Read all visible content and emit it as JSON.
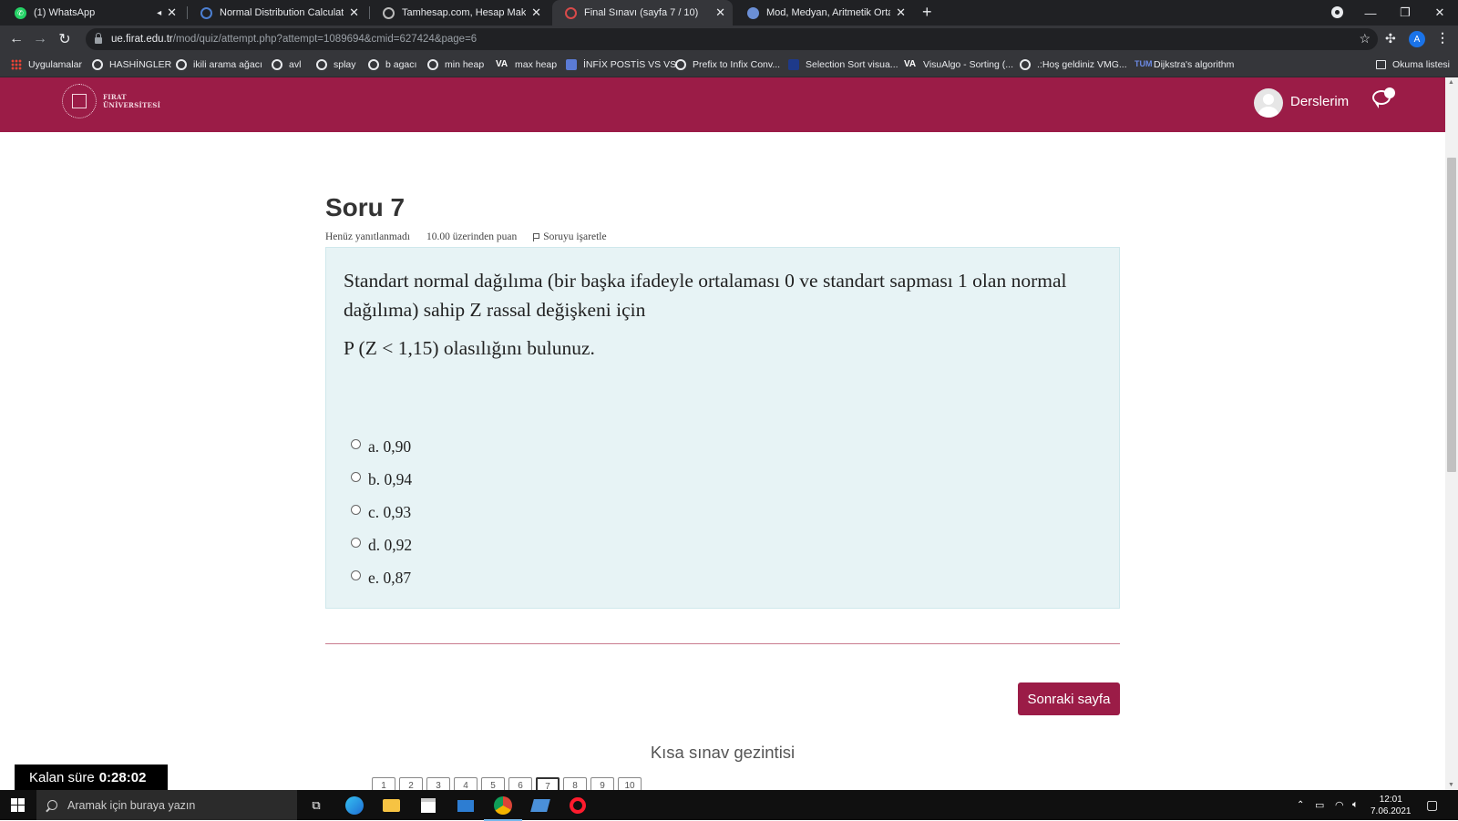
{
  "browser": {
    "tabs": [
      {
        "title": "(1) WhatsApp",
        "muted": true
      },
      {
        "title": "Normal Distribution Calculator | Ir"
      },
      {
        "title": "Tamhesap.com, Hesap Makinesi, Ç"
      },
      {
        "title": "Final Sınavı (sayfa 7 / 10)",
        "active": true
      },
      {
        "title": "Mod, Medyan, Aritmetik Ortalama"
      }
    ],
    "url_host": "ue.firat.edu.tr",
    "url_path": "/mod/quiz/attempt.php?attempt=1089694&cmid=627424&page=6",
    "profile_initial": "A",
    "bookmarks": [
      "Uygulamalar",
      "HASHİNGLER",
      "ikili arama ağacı",
      "avl",
      "splay",
      "b agacı",
      "min heap",
      "max heap",
      "İNFİX POSTİS VS VS",
      "Prefix to Infix Conv...",
      "Selection Sort visua...",
      "VisuAlgo - Sorting (...",
      ".:Hoş geldiniz VMG...",
      "Dijkstra's algorithm",
      "Okuma listesi"
    ]
  },
  "site": {
    "logo_line1": "FIRAT",
    "logo_line2": "ÜNİVERSİTESİ",
    "my_courses": "Derslerim",
    "accent_color": "#9b1c47"
  },
  "question": {
    "title": "Soru 7",
    "status": "Henüz yanıtlanmadı",
    "points": "10.00 üzerinden puan",
    "flag_label": "Soruyu işaretle",
    "text": "Standart normal dağılıma (bir başka ifadeyle ortalaması 0 ve standart sapması 1 olan normal dağılıma) sahip Z rassal değişkeni için",
    "prompt": "P (Z < 1,15) olasılığını bulunuz.",
    "options": [
      "a. 0,90",
      "b. 0,94",
      "c. 0,93",
      "d. 0,92",
      "e. 0,87"
    ]
  },
  "next_button": "Sonraki sayfa",
  "quiz_nav": {
    "title": "Kısa sınav gezintisi",
    "pages": [
      "1",
      "2",
      "3",
      "4",
      "5",
      "6",
      "7",
      "8",
      "9",
      "10"
    ],
    "current": "7"
  },
  "timer": {
    "label": "Kalan süre",
    "value": "0:28:02"
  },
  "taskbar": {
    "search_placeholder": "Aramak için buraya yazın",
    "time": "12:01",
    "date": "7.06.2021"
  }
}
